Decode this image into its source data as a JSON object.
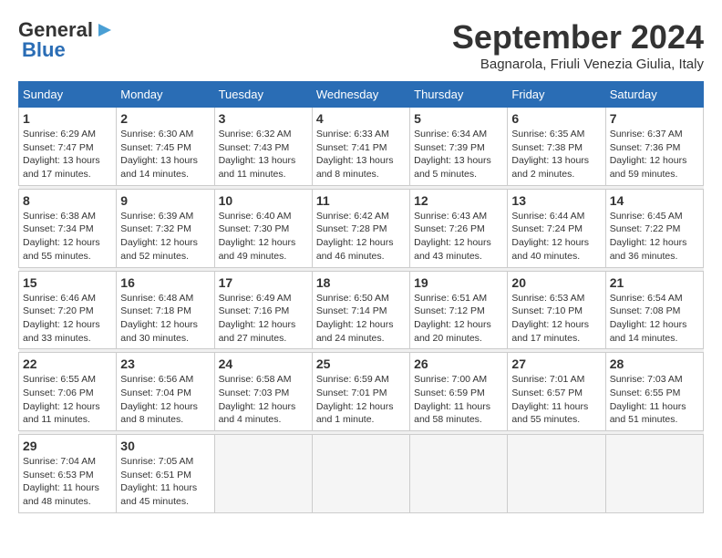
{
  "logo": {
    "text1": "General",
    "text2": "Blue"
  },
  "header": {
    "month": "September 2024",
    "location": "Bagnarola, Friuli Venezia Giulia, Italy"
  },
  "weekdays": [
    "Sunday",
    "Monday",
    "Tuesday",
    "Wednesday",
    "Thursday",
    "Friday",
    "Saturday"
  ],
  "weeks": [
    [
      {
        "day": "1",
        "sunrise": "6:29 AM",
        "sunset": "7:47 PM",
        "daylight": "13 hours and 17 minutes."
      },
      {
        "day": "2",
        "sunrise": "6:30 AM",
        "sunset": "7:45 PM",
        "daylight": "13 hours and 14 minutes."
      },
      {
        "day": "3",
        "sunrise": "6:32 AM",
        "sunset": "7:43 PM",
        "daylight": "13 hours and 11 minutes."
      },
      {
        "day": "4",
        "sunrise": "6:33 AM",
        "sunset": "7:41 PM",
        "daylight": "13 hours and 8 minutes."
      },
      {
        "day": "5",
        "sunrise": "6:34 AM",
        "sunset": "7:39 PM",
        "daylight": "13 hours and 5 minutes."
      },
      {
        "day": "6",
        "sunrise": "6:35 AM",
        "sunset": "7:38 PM",
        "daylight": "13 hours and 2 minutes."
      },
      {
        "day": "7",
        "sunrise": "6:37 AM",
        "sunset": "7:36 PM",
        "daylight": "12 hours and 59 minutes."
      }
    ],
    [
      {
        "day": "8",
        "sunrise": "6:38 AM",
        "sunset": "7:34 PM",
        "daylight": "12 hours and 55 minutes."
      },
      {
        "day": "9",
        "sunrise": "6:39 AM",
        "sunset": "7:32 PM",
        "daylight": "12 hours and 52 minutes."
      },
      {
        "day": "10",
        "sunrise": "6:40 AM",
        "sunset": "7:30 PM",
        "daylight": "12 hours and 49 minutes."
      },
      {
        "day": "11",
        "sunrise": "6:42 AM",
        "sunset": "7:28 PM",
        "daylight": "12 hours and 46 minutes."
      },
      {
        "day": "12",
        "sunrise": "6:43 AM",
        "sunset": "7:26 PM",
        "daylight": "12 hours and 43 minutes."
      },
      {
        "day": "13",
        "sunrise": "6:44 AM",
        "sunset": "7:24 PM",
        "daylight": "12 hours and 40 minutes."
      },
      {
        "day": "14",
        "sunrise": "6:45 AM",
        "sunset": "7:22 PM",
        "daylight": "12 hours and 36 minutes."
      }
    ],
    [
      {
        "day": "15",
        "sunrise": "6:46 AM",
        "sunset": "7:20 PM",
        "daylight": "12 hours and 33 minutes."
      },
      {
        "day": "16",
        "sunrise": "6:48 AM",
        "sunset": "7:18 PM",
        "daylight": "12 hours and 30 minutes."
      },
      {
        "day": "17",
        "sunrise": "6:49 AM",
        "sunset": "7:16 PM",
        "daylight": "12 hours and 27 minutes."
      },
      {
        "day": "18",
        "sunrise": "6:50 AM",
        "sunset": "7:14 PM",
        "daylight": "12 hours and 24 minutes."
      },
      {
        "day": "19",
        "sunrise": "6:51 AM",
        "sunset": "7:12 PM",
        "daylight": "12 hours and 20 minutes."
      },
      {
        "day": "20",
        "sunrise": "6:53 AM",
        "sunset": "7:10 PM",
        "daylight": "12 hours and 17 minutes."
      },
      {
        "day": "21",
        "sunrise": "6:54 AM",
        "sunset": "7:08 PM",
        "daylight": "12 hours and 14 minutes."
      }
    ],
    [
      {
        "day": "22",
        "sunrise": "6:55 AM",
        "sunset": "7:06 PM",
        "daylight": "12 hours and 11 minutes."
      },
      {
        "day": "23",
        "sunrise": "6:56 AM",
        "sunset": "7:04 PM",
        "daylight": "12 hours and 8 minutes."
      },
      {
        "day": "24",
        "sunrise": "6:58 AM",
        "sunset": "7:03 PM",
        "daylight": "12 hours and 4 minutes."
      },
      {
        "day": "25",
        "sunrise": "6:59 AM",
        "sunset": "7:01 PM",
        "daylight": "12 hours and 1 minute."
      },
      {
        "day": "26",
        "sunrise": "7:00 AM",
        "sunset": "6:59 PM",
        "daylight": "11 hours and 58 minutes."
      },
      {
        "day": "27",
        "sunrise": "7:01 AM",
        "sunset": "6:57 PM",
        "daylight": "11 hours and 55 minutes."
      },
      {
        "day": "28",
        "sunrise": "7:03 AM",
        "sunset": "6:55 PM",
        "daylight": "11 hours and 51 minutes."
      }
    ],
    [
      {
        "day": "29",
        "sunrise": "7:04 AM",
        "sunset": "6:53 PM",
        "daylight": "11 hours and 48 minutes."
      },
      {
        "day": "30",
        "sunrise": "7:05 AM",
        "sunset": "6:51 PM",
        "daylight": "11 hours and 45 minutes."
      },
      null,
      null,
      null,
      null,
      null
    ]
  ],
  "labels": {
    "sunrise": "Sunrise:",
    "sunset": "Sunset:",
    "daylight": "Daylight:"
  }
}
